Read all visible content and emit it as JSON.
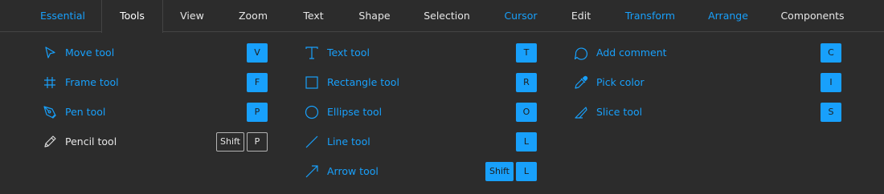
{
  "colors": {
    "accent": "#18a0fb",
    "background": "#2c2c2c",
    "text": "#e6e6e6",
    "muted_key_border": "#b3b3b3"
  },
  "tabs": [
    {
      "label": "Essential",
      "color": "#18a0fb"
    },
    {
      "label": "Tools",
      "color": "#ffffff"
    },
    {
      "label": "View",
      "color": "#e6e6e6"
    },
    {
      "label": "Zoom",
      "color": "#e6e6e6"
    },
    {
      "label": "Text",
      "color": "#e6e6e6"
    },
    {
      "label": "Shape",
      "color": "#e6e6e6"
    },
    {
      "label": "Selection",
      "color": "#e6e6e6"
    },
    {
      "label": "Cursor",
      "color": "#18a0fb"
    },
    {
      "label": "Edit",
      "color": "#e6e6e6"
    },
    {
      "label": "Transform",
      "color": "#18a0fb"
    },
    {
      "label": "Arrange",
      "color": "#18a0fb"
    },
    {
      "label": "Components",
      "color": "#e6e6e6"
    }
  ],
  "active_tab": "Tools",
  "shortcuts": [
    {
      "label": "Move tool",
      "icon": "move-icon",
      "keys": [
        "V"
      ],
      "learned": true
    },
    {
      "label": "Frame tool",
      "icon": "frame-icon",
      "keys": [
        "F"
      ],
      "learned": true
    },
    {
      "label": "Pen tool",
      "icon": "pen-icon",
      "keys": [
        "P"
      ],
      "learned": true
    },
    {
      "label": "Pencil tool",
      "icon": "pencil-icon",
      "keys": [
        "Shift",
        "P"
      ],
      "learned": false
    },
    {
      "label": "Text tool",
      "icon": "text-icon",
      "keys": [
        "T"
      ],
      "learned": true
    },
    {
      "label": "Rectangle tool",
      "icon": "rectangle-icon",
      "keys": [
        "R"
      ],
      "learned": true
    },
    {
      "label": "Ellipse tool",
      "icon": "ellipse-icon",
      "keys": [
        "O"
      ],
      "learned": true
    },
    {
      "label": "Line tool",
      "icon": "line-icon",
      "keys": [
        "L"
      ],
      "learned": true
    },
    {
      "label": "Arrow tool",
      "icon": "arrow-icon",
      "keys": [
        "Shift",
        "L"
      ],
      "learned": true
    },
    {
      "label": "Add comment",
      "icon": "comment-icon",
      "keys": [
        "C"
      ],
      "learned": true
    },
    {
      "label": "Pick color",
      "icon": "eyedropper-icon",
      "keys": [
        "I"
      ],
      "learned": true
    },
    {
      "label": "Slice tool",
      "icon": "slice-icon",
      "keys": [
        "S"
      ],
      "learned": true
    }
  ]
}
